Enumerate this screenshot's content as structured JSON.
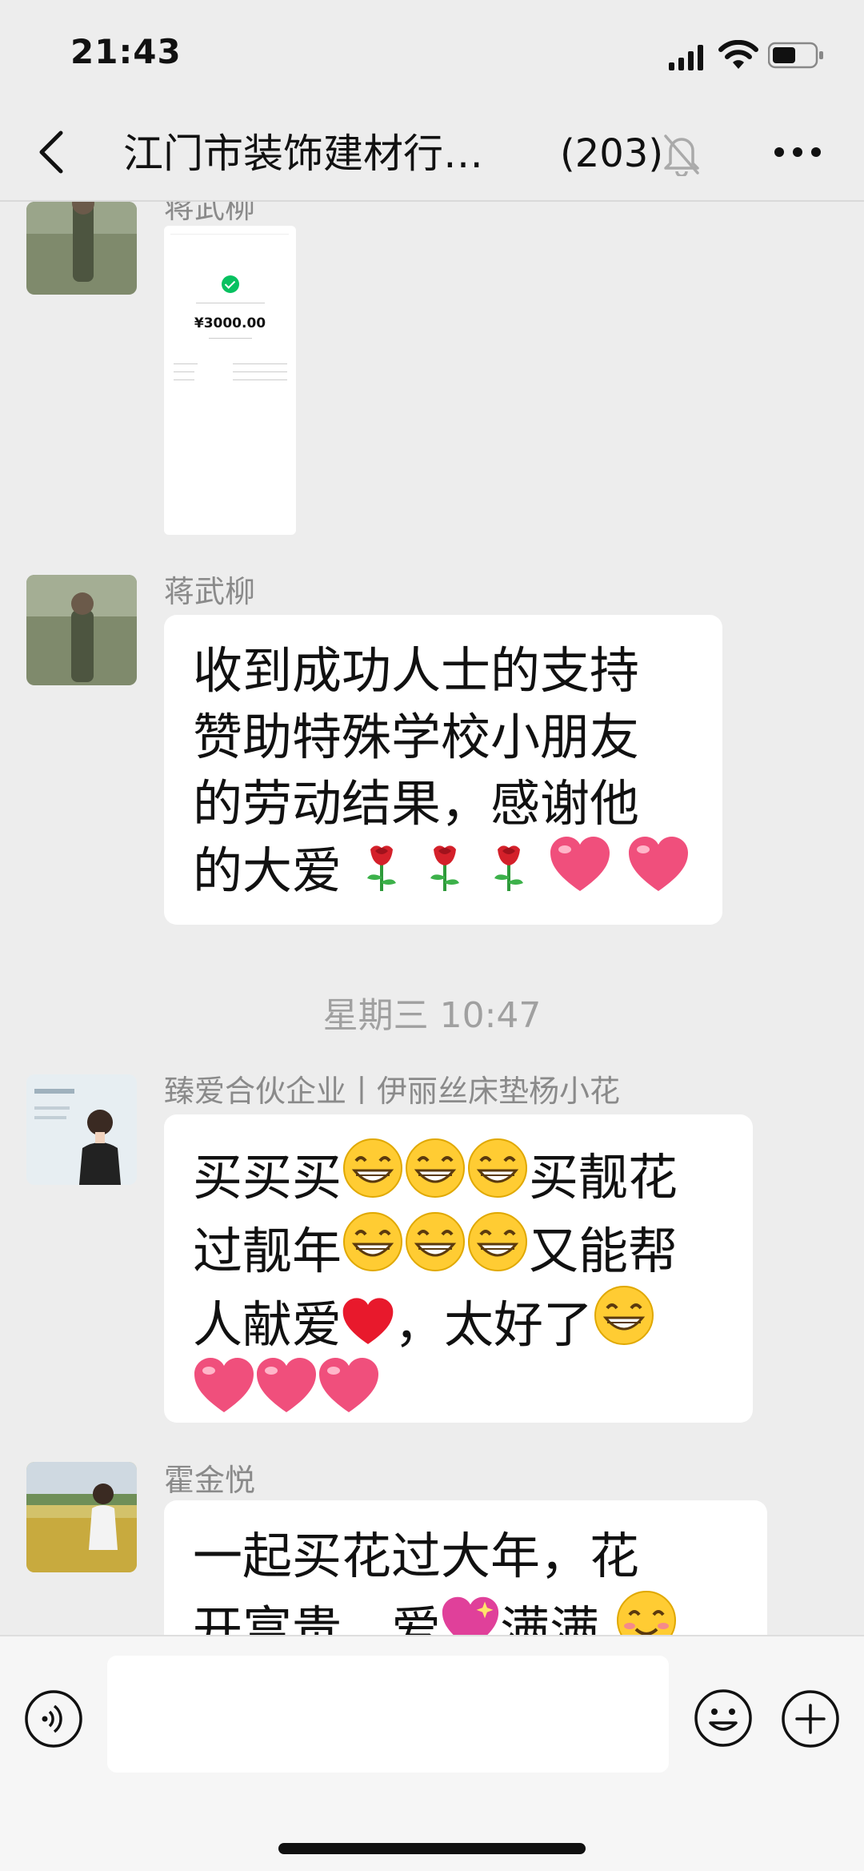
{
  "status_bar": {
    "time": "21:43"
  },
  "header": {
    "title": "江门市装饰建材行…",
    "member_count": "(203)"
  },
  "messages": [
    {
      "sender": "蒋武柳",
      "type": "image",
      "image_text": {
        "amount": "¥3000.00"
      }
    },
    {
      "sender": "蒋武柳",
      "lines": [
        "收到成功人士的支持",
        "赞助特殊学校小朋友",
        "的劳动结果，感谢他",
        "的大爱"
      ]
    },
    {
      "timestamp": "星期三 10:47"
    },
    {
      "sender": "臻爱合伙企业丨伊丽丝床垫杨小花",
      "segments": [
        "买买买",
        "买靓花",
        "过靓年",
        "又能帮",
        "人献爱",
        "，太好了"
      ]
    },
    {
      "sender": "霍金悦",
      "lines": [
        "一起买花过大年，花",
        "开富贵，爱",
        "满满"
      ]
    }
  ],
  "input": {
    "placeholder": ""
  },
  "colors": {
    "background": "#ededed",
    "bubble": "#ffffff",
    "sender_text": "#8a8a8a",
    "timestamp_text": "#a0a0a0"
  }
}
